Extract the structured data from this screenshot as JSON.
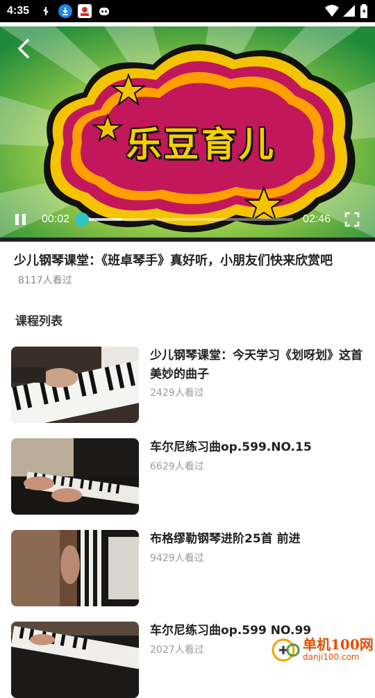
{
  "status_bar": {
    "time": "4:35",
    "icons": [
      "usb-icon",
      "download-icon",
      "app-icon",
      "robot-icon"
    ],
    "right_icons": [
      "wifi-icon",
      "signal-icon",
      "battery-icon"
    ]
  },
  "player": {
    "banner_text": "乐豆育儿",
    "current_time": "00:02",
    "duration": "02:46",
    "progress": 0.012,
    "buffered": 0.2
  },
  "video": {
    "title": "少儿钢琴课堂：《班卓琴手》真好听，小朋友们快来欣赏吧",
    "views": "8117人看过"
  },
  "section": {
    "title": "课程列表"
  },
  "courses": [
    {
      "title": "少儿钢琴课堂：今天学习《划呀划》这首美妙的曲子",
      "views": "2429人看过"
    },
    {
      "title": "车尔尼练习曲op.599.NO.15",
      "views": "6629人看过"
    },
    {
      "title": "布格缪勒钢琴进阶25首 前进",
      "views": "9429人看过"
    },
    {
      "title": "车尔尼练习曲op.599 NO.99",
      "views": "2027人看过"
    }
  ],
  "watermark": {
    "text": "单机100网",
    "sub": "danji100.com"
  },
  "colors": {
    "accent": "#2ec4c4",
    "banner_pink": "#c2185b",
    "banner_yellow": "#f5c400"
  }
}
